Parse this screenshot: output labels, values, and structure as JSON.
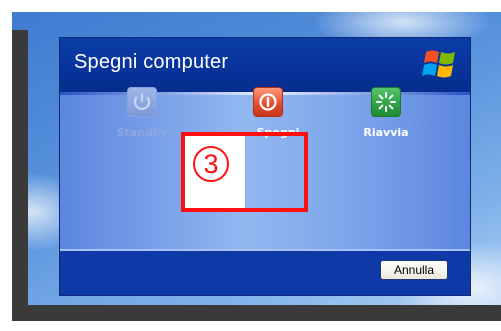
{
  "dialog": {
    "title": "Spegni computer",
    "logo_icon": "windows-xp-flag-icon"
  },
  "options": [
    {
      "label": "Standby",
      "icon": "power-icon",
      "state": "disabled"
    },
    {
      "label": "Spegni",
      "icon": "power-off-icon",
      "state": "enabled"
    },
    {
      "label": "Riavvia",
      "icon": "restart-icon",
      "state": "enabled"
    }
  ],
  "footer": {
    "cancel_label": "Annulla"
  },
  "annotation": {
    "step_number": "3",
    "color": "#ff1010"
  },
  "colors": {
    "header": "#08339a",
    "footer": "#0d3aa6",
    "body": "#7ea6ec"
  }
}
